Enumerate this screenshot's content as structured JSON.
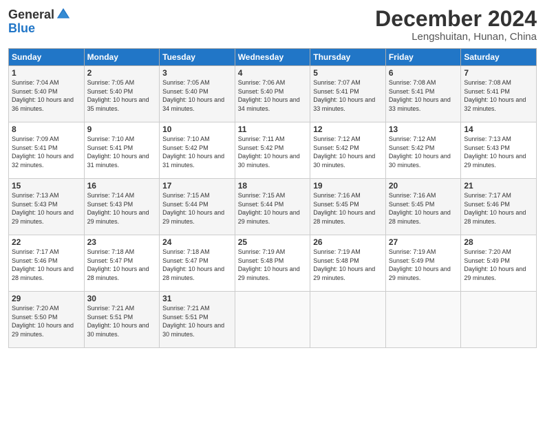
{
  "header": {
    "logo_general": "General",
    "logo_blue": "Blue",
    "month_title": "December 2024",
    "location": "Lengshuitan, Hunan, China"
  },
  "calendar": {
    "weekdays": [
      "Sunday",
      "Monday",
      "Tuesday",
      "Wednesday",
      "Thursday",
      "Friday",
      "Saturday"
    ],
    "weeks": [
      [
        {
          "day": "1",
          "sunrise": "7:04 AM",
          "sunset": "5:40 PM",
          "daylight": "10 hours and 36 minutes."
        },
        {
          "day": "2",
          "sunrise": "7:05 AM",
          "sunset": "5:40 PM",
          "daylight": "10 hours and 35 minutes."
        },
        {
          "day": "3",
          "sunrise": "7:05 AM",
          "sunset": "5:40 PM",
          "daylight": "10 hours and 34 minutes."
        },
        {
          "day": "4",
          "sunrise": "7:06 AM",
          "sunset": "5:40 PM",
          "daylight": "10 hours and 34 minutes."
        },
        {
          "day": "5",
          "sunrise": "7:07 AM",
          "sunset": "5:41 PM",
          "daylight": "10 hours and 33 minutes."
        },
        {
          "day": "6",
          "sunrise": "7:08 AM",
          "sunset": "5:41 PM",
          "daylight": "10 hours and 33 minutes."
        },
        {
          "day": "7",
          "sunrise": "7:08 AM",
          "sunset": "5:41 PM",
          "daylight": "10 hours and 32 minutes."
        }
      ],
      [
        {
          "day": "8",
          "sunrise": "7:09 AM",
          "sunset": "5:41 PM",
          "daylight": "10 hours and 32 minutes."
        },
        {
          "day": "9",
          "sunrise": "7:10 AM",
          "sunset": "5:41 PM",
          "daylight": "10 hours and 31 minutes."
        },
        {
          "day": "10",
          "sunrise": "7:10 AM",
          "sunset": "5:42 PM",
          "daylight": "10 hours and 31 minutes."
        },
        {
          "day": "11",
          "sunrise": "7:11 AM",
          "sunset": "5:42 PM",
          "daylight": "10 hours and 30 minutes."
        },
        {
          "day": "12",
          "sunrise": "7:12 AM",
          "sunset": "5:42 PM",
          "daylight": "10 hours and 30 minutes."
        },
        {
          "day": "13",
          "sunrise": "7:12 AM",
          "sunset": "5:42 PM",
          "daylight": "10 hours and 30 minutes."
        },
        {
          "day": "14",
          "sunrise": "7:13 AM",
          "sunset": "5:43 PM",
          "daylight": "10 hours and 29 minutes."
        }
      ],
      [
        {
          "day": "15",
          "sunrise": "7:13 AM",
          "sunset": "5:43 PM",
          "daylight": "10 hours and 29 minutes."
        },
        {
          "day": "16",
          "sunrise": "7:14 AM",
          "sunset": "5:43 PM",
          "daylight": "10 hours and 29 minutes."
        },
        {
          "day": "17",
          "sunrise": "7:15 AM",
          "sunset": "5:44 PM",
          "daylight": "10 hours and 29 minutes."
        },
        {
          "day": "18",
          "sunrise": "7:15 AM",
          "sunset": "5:44 PM",
          "daylight": "10 hours and 29 minutes."
        },
        {
          "day": "19",
          "sunrise": "7:16 AM",
          "sunset": "5:45 PM",
          "daylight": "10 hours and 28 minutes."
        },
        {
          "day": "20",
          "sunrise": "7:16 AM",
          "sunset": "5:45 PM",
          "daylight": "10 hours and 28 minutes."
        },
        {
          "day": "21",
          "sunrise": "7:17 AM",
          "sunset": "5:46 PM",
          "daylight": "10 hours and 28 minutes."
        }
      ],
      [
        {
          "day": "22",
          "sunrise": "7:17 AM",
          "sunset": "5:46 PM",
          "daylight": "10 hours and 28 minutes."
        },
        {
          "day": "23",
          "sunrise": "7:18 AM",
          "sunset": "5:47 PM",
          "daylight": "10 hours and 28 minutes."
        },
        {
          "day": "24",
          "sunrise": "7:18 AM",
          "sunset": "5:47 PM",
          "daylight": "10 hours and 28 minutes."
        },
        {
          "day": "25",
          "sunrise": "7:19 AM",
          "sunset": "5:48 PM",
          "daylight": "10 hours and 29 minutes."
        },
        {
          "day": "26",
          "sunrise": "7:19 AM",
          "sunset": "5:48 PM",
          "daylight": "10 hours and 29 minutes."
        },
        {
          "day": "27",
          "sunrise": "7:19 AM",
          "sunset": "5:49 PM",
          "daylight": "10 hours and 29 minutes."
        },
        {
          "day": "28",
          "sunrise": "7:20 AM",
          "sunset": "5:49 PM",
          "daylight": "10 hours and 29 minutes."
        }
      ],
      [
        {
          "day": "29",
          "sunrise": "7:20 AM",
          "sunset": "5:50 PM",
          "daylight": "10 hours and 29 minutes."
        },
        {
          "day": "30",
          "sunrise": "7:21 AM",
          "sunset": "5:51 PM",
          "daylight": "10 hours and 30 minutes."
        },
        {
          "day": "31",
          "sunrise": "7:21 AM",
          "sunset": "5:51 PM",
          "daylight": "10 hours and 30 minutes."
        },
        null,
        null,
        null,
        null
      ]
    ]
  }
}
